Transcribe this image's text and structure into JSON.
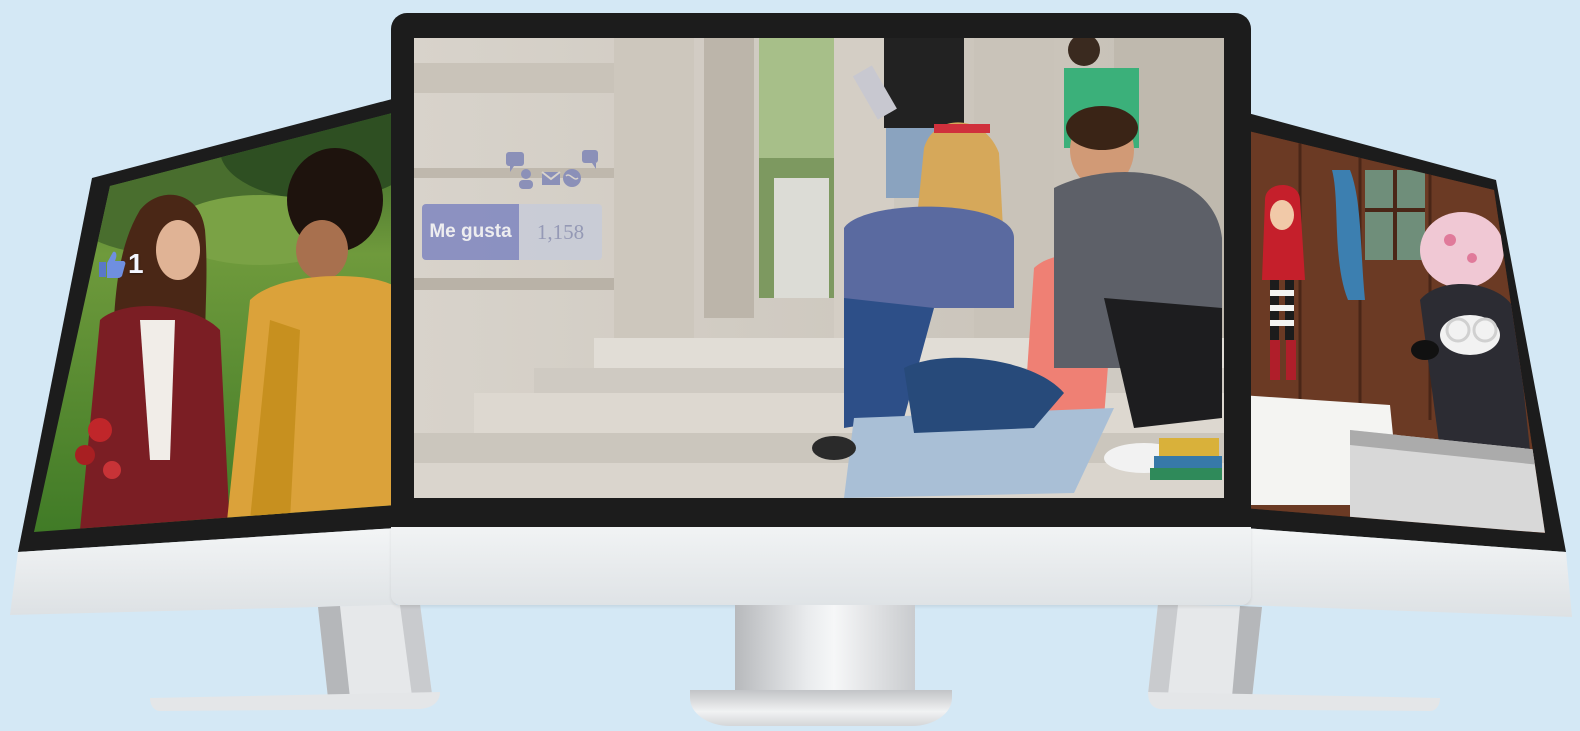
{
  "background_color": "#d4e8f5",
  "center_screen": {
    "like_button": {
      "label": "Me gusta",
      "count": "1,158"
    },
    "social_icons": [
      "comment-icon",
      "user-icon",
      "mail-icon",
      "globe-icon",
      "comment-icon"
    ]
  },
  "left_screen": {
    "like_badge": {
      "icon": "thumbs-up-icon",
      "count": "1"
    }
  },
  "right_screen": {
    "scene": "illustration-icon"
  }
}
